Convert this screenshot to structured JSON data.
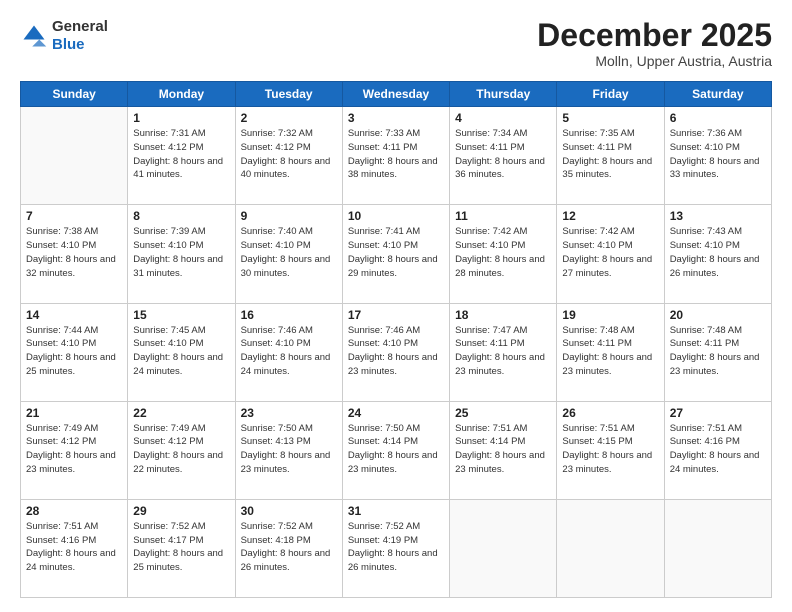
{
  "header": {
    "logo_general": "General",
    "logo_blue": "Blue",
    "month_title": "December 2025",
    "location": "Molln, Upper Austria, Austria"
  },
  "days_of_week": [
    "Sunday",
    "Monday",
    "Tuesday",
    "Wednesday",
    "Thursday",
    "Friday",
    "Saturday"
  ],
  "weeks": [
    [
      {
        "day": null,
        "sunrise": null,
        "sunset": null,
        "daylight": null
      },
      {
        "day": "1",
        "sunrise": "7:31 AM",
        "sunset": "4:12 PM",
        "daylight": "8 hours and 41 minutes."
      },
      {
        "day": "2",
        "sunrise": "7:32 AM",
        "sunset": "4:12 PM",
        "daylight": "8 hours and 40 minutes."
      },
      {
        "day": "3",
        "sunrise": "7:33 AM",
        "sunset": "4:11 PM",
        "daylight": "8 hours and 38 minutes."
      },
      {
        "day": "4",
        "sunrise": "7:34 AM",
        "sunset": "4:11 PM",
        "daylight": "8 hours and 36 minutes."
      },
      {
        "day": "5",
        "sunrise": "7:35 AM",
        "sunset": "4:11 PM",
        "daylight": "8 hours and 35 minutes."
      },
      {
        "day": "6",
        "sunrise": "7:36 AM",
        "sunset": "4:10 PM",
        "daylight": "8 hours and 33 minutes."
      }
    ],
    [
      {
        "day": "7",
        "sunrise": "7:38 AM",
        "sunset": "4:10 PM",
        "daylight": "8 hours and 32 minutes."
      },
      {
        "day": "8",
        "sunrise": "7:39 AM",
        "sunset": "4:10 PM",
        "daylight": "8 hours and 31 minutes."
      },
      {
        "day": "9",
        "sunrise": "7:40 AM",
        "sunset": "4:10 PM",
        "daylight": "8 hours and 30 minutes."
      },
      {
        "day": "10",
        "sunrise": "7:41 AM",
        "sunset": "4:10 PM",
        "daylight": "8 hours and 29 minutes."
      },
      {
        "day": "11",
        "sunrise": "7:42 AM",
        "sunset": "4:10 PM",
        "daylight": "8 hours and 28 minutes."
      },
      {
        "day": "12",
        "sunrise": "7:42 AM",
        "sunset": "4:10 PM",
        "daylight": "8 hours and 27 minutes."
      },
      {
        "day": "13",
        "sunrise": "7:43 AM",
        "sunset": "4:10 PM",
        "daylight": "8 hours and 26 minutes."
      }
    ],
    [
      {
        "day": "14",
        "sunrise": "7:44 AM",
        "sunset": "4:10 PM",
        "daylight": "8 hours and 25 minutes."
      },
      {
        "day": "15",
        "sunrise": "7:45 AM",
        "sunset": "4:10 PM",
        "daylight": "8 hours and 24 minutes."
      },
      {
        "day": "16",
        "sunrise": "7:46 AM",
        "sunset": "4:10 PM",
        "daylight": "8 hours and 24 minutes."
      },
      {
        "day": "17",
        "sunrise": "7:46 AM",
        "sunset": "4:10 PM",
        "daylight": "8 hours and 23 minutes."
      },
      {
        "day": "18",
        "sunrise": "7:47 AM",
        "sunset": "4:11 PM",
        "daylight": "8 hours and 23 minutes."
      },
      {
        "day": "19",
        "sunrise": "7:48 AM",
        "sunset": "4:11 PM",
        "daylight": "8 hours and 23 minutes."
      },
      {
        "day": "20",
        "sunrise": "7:48 AM",
        "sunset": "4:11 PM",
        "daylight": "8 hours and 23 minutes."
      }
    ],
    [
      {
        "day": "21",
        "sunrise": "7:49 AM",
        "sunset": "4:12 PM",
        "daylight": "8 hours and 23 minutes."
      },
      {
        "day": "22",
        "sunrise": "7:49 AM",
        "sunset": "4:12 PM",
        "daylight": "8 hours and 22 minutes."
      },
      {
        "day": "23",
        "sunrise": "7:50 AM",
        "sunset": "4:13 PM",
        "daylight": "8 hours and 23 minutes."
      },
      {
        "day": "24",
        "sunrise": "7:50 AM",
        "sunset": "4:14 PM",
        "daylight": "8 hours and 23 minutes."
      },
      {
        "day": "25",
        "sunrise": "7:51 AM",
        "sunset": "4:14 PM",
        "daylight": "8 hours and 23 minutes."
      },
      {
        "day": "26",
        "sunrise": "7:51 AM",
        "sunset": "4:15 PM",
        "daylight": "8 hours and 23 minutes."
      },
      {
        "day": "27",
        "sunrise": "7:51 AM",
        "sunset": "4:16 PM",
        "daylight": "8 hours and 24 minutes."
      }
    ],
    [
      {
        "day": "28",
        "sunrise": "7:51 AM",
        "sunset": "4:16 PM",
        "daylight": "8 hours and 24 minutes."
      },
      {
        "day": "29",
        "sunrise": "7:52 AM",
        "sunset": "4:17 PM",
        "daylight": "8 hours and 25 minutes."
      },
      {
        "day": "30",
        "sunrise": "7:52 AM",
        "sunset": "4:18 PM",
        "daylight": "8 hours and 26 minutes."
      },
      {
        "day": "31",
        "sunrise": "7:52 AM",
        "sunset": "4:19 PM",
        "daylight": "8 hours and 26 minutes."
      },
      {
        "day": null,
        "sunrise": null,
        "sunset": null,
        "daylight": null
      },
      {
        "day": null,
        "sunrise": null,
        "sunset": null,
        "daylight": null
      },
      {
        "day": null,
        "sunrise": null,
        "sunset": null,
        "daylight": null
      }
    ]
  ],
  "labels": {
    "sunrise": "Sunrise:",
    "sunset": "Sunset:",
    "daylight": "Daylight:"
  }
}
